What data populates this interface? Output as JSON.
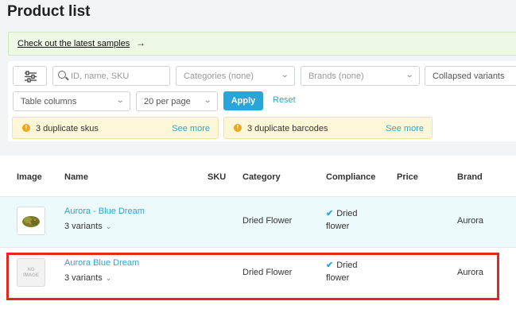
{
  "page": {
    "title": "Product list"
  },
  "banner": {
    "link_text": "Check out the latest samples",
    "arrow": "→"
  },
  "filters": {
    "search_placeholder": "ID, name, SKU",
    "categories": "Categories (none)",
    "brands": "Brands (none)",
    "collapsed_variants": "Collapsed variants",
    "table_columns": "Table columns",
    "per_page": "20 per page",
    "apply_label": "Apply",
    "reset_label": "Reset"
  },
  "warnings": [
    {
      "text": "3 duplicate skus",
      "link": "See more"
    },
    {
      "text": "3 duplicate barcodes",
      "link": "See more"
    }
  ],
  "table": {
    "columns": [
      "Image",
      "Name",
      "SKU",
      "Category",
      "Compliance",
      "Price",
      "Brand"
    ],
    "rows": [
      {
        "image": "product-photo",
        "name": "Aurora - Blue Dream",
        "variants": "3 variants",
        "sku": "",
        "category": "Dried Flower",
        "compliance_line1": "Dried",
        "compliance_line2": "flower",
        "price": "",
        "brand": "Aurora"
      },
      {
        "image": "no-image",
        "image_placeholder_line1": "NO",
        "image_placeholder_line2": "IMAGE",
        "name": "Aurora Blue Dream",
        "variants": "3 variants",
        "sku": "",
        "category": "Dried Flower",
        "compliance_line1": "Dried",
        "compliance_line2": "flower",
        "price": "",
        "brand": "Aurora"
      }
    ]
  },
  "colors": {
    "accent": "#29a6d9",
    "highlight_border": "#e8261b",
    "warning_bg": "#fdf7d8",
    "banner_bg": "#eef8e6"
  }
}
